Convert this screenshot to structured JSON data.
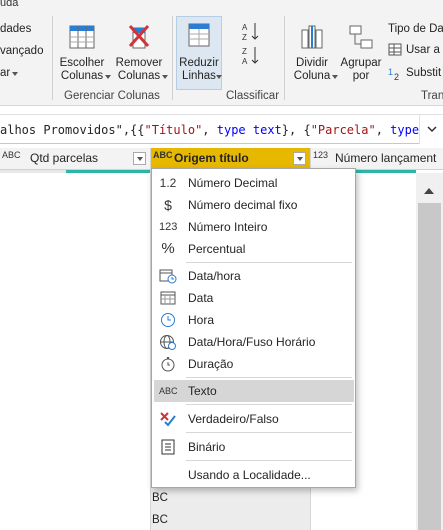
{
  "window": {
    "title_fragment": "uda"
  },
  "ribbon": {
    "left_partial": [
      "dades",
      "vançado",
      "ar"
    ],
    "choose_columns": {
      "line1": "Escolher",
      "line2": "Colunas"
    },
    "remove_columns": {
      "line1": "Remover",
      "line2": "Colunas"
    },
    "manage_columns_group": "Gerenciar Colunas",
    "reduce_rows": {
      "line1": "Reduzir",
      "line2": "Linhas"
    },
    "sort_group": "Classificar",
    "split_column": {
      "line1": "Dividir",
      "line2": "Coluna"
    },
    "group_by": {
      "line1": "Agrupar",
      "line2": "por"
    },
    "data_type": "Tipo de Da",
    "use_first_row": "Usar a",
    "replace_values": "Substit",
    "transform_group_fragment": "Tran"
  },
  "formula": {
    "part1": "alhos Promovidos\",{{",
    "str1": "\"Título\"",
    "part2": ", ",
    "kw1": "type text",
    "part3": "}, {",
    "str2": "\"Parcela\"",
    "part4": ", ",
    "kw2": "type"
  },
  "grid": {
    "columns": [
      {
        "type_icon": "ABC",
        "name": "Qtd parcelas"
      },
      {
        "type_icon": "ABC",
        "name": "Origem título"
      },
      {
        "type_icon": "123",
        "name": "Número lançament"
      }
    ],
    "visible_values": [
      "BC",
      "BC"
    ]
  },
  "type_menu": {
    "items": [
      {
        "icon": "1.2",
        "label": "Número Decimal"
      },
      {
        "icon": "$",
        "label": "Número decimal fixo"
      },
      {
        "icon": "123",
        "label": "Número Inteiro"
      },
      {
        "icon": "%",
        "label": "Percentual"
      },
      {
        "icon": "calendar-clock",
        "label": "Data/hora"
      },
      {
        "icon": "calendar",
        "label": "Data"
      },
      {
        "icon": "clock",
        "label": "Hora"
      },
      {
        "icon": "globe-clock",
        "label": "Data/Hora/Fuso Horário"
      },
      {
        "icon": "stopwatch",
        "label": "Duração"
      },
      {
        "icon": "ABC",
        "label": "Texto"
      },
      {
        "icon": "x-check",
        "label": "Verdadeiro/Falso"
      },
      {
        "icon": "binary",
        "label": "Binário"
      },
      {
        "icon": "",
        "label": "Usando a Localidade..."
      }
    ],
    "highlighted": "Texto"
  },
  "colors": {
    "active_header": "#e6b800",
    "quality_bar_teal": "#2bb6a8",
    "menu_highlight": "#d6d6d6"
  }
}
